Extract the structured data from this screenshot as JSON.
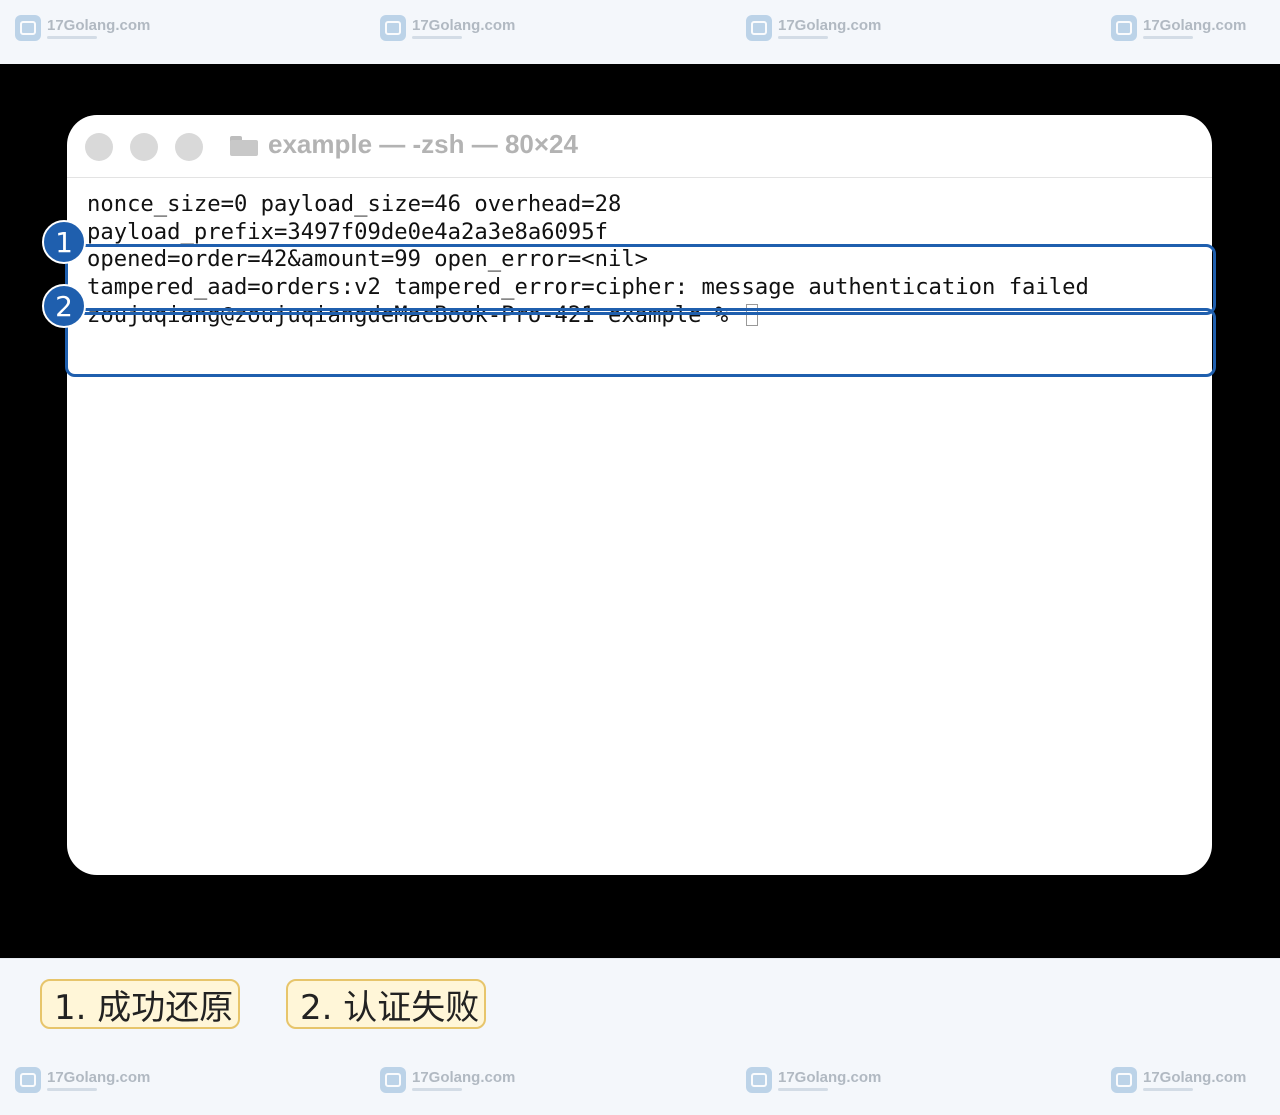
{
  "watermark": {
    "brand": "17Golang.com"
  },
  "terminal": {
    "title": "example — -zsh — 80×24",
    "lines": [
      "nonce_size=0 payload_size=46 overhead=28",
      "payload_prefix=3497f09de0e4a2a3e8a6095f",
      "opened=order=42&amount=99 open_error=<nil>",
      "tampered_aad=orders:v2 tampered_error=cipher: message authentication failed",
      "zoujuqiang@zoujuqiangdeMacBook-Pro-421 example % "
    ]
  },
  "badges": [
    "1",
    "2"
  ],
  "legend": [
    "1. 成功还原",
    "2. 认证失败"
  ],
  "colors": {
    "accent": "#1f5fae",
    "legend_bg": "#fff6d8",
    "legend_border": "#e7c56b"
  }
}
